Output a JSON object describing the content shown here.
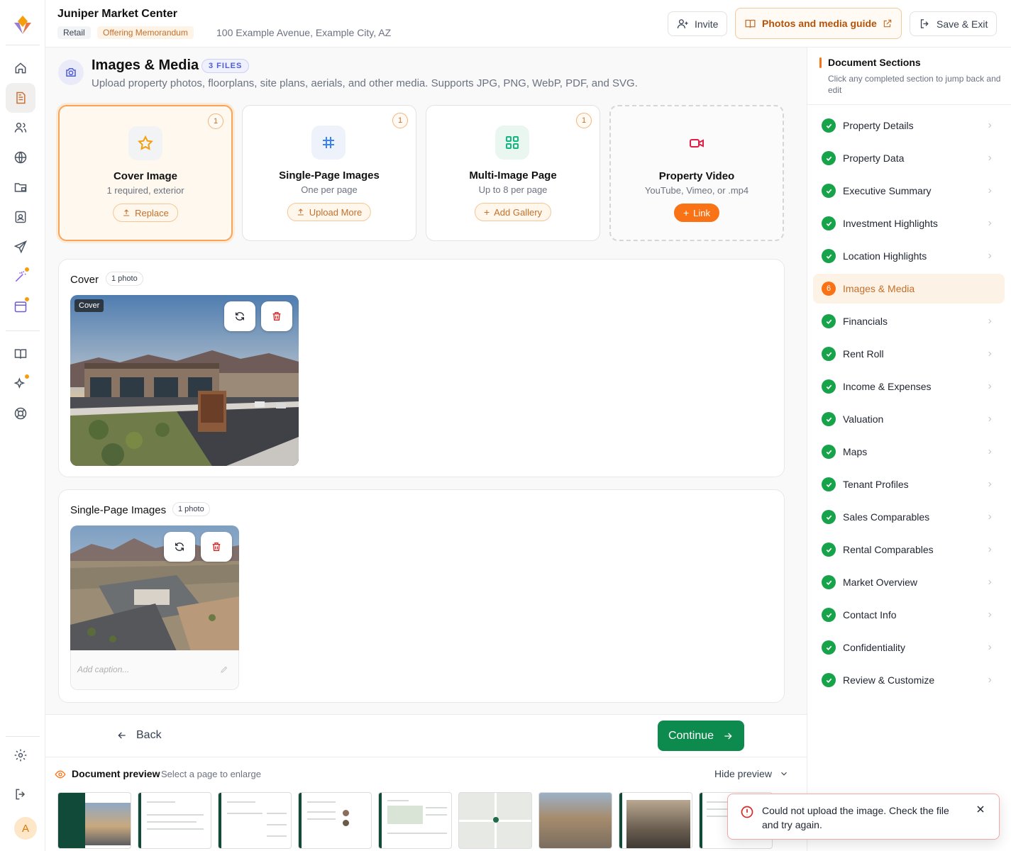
{
  "project": {
    "title": "Juniper Market Center",
    "tags": [
      "Retail",
      "Offering Memorandum"
    ],
    "address": "100 Example Avenue, Example City, AZ"
  },
  "topbar": {
    "invite": "Invite",
    "guide": "Photos and media guide",
    "save_exit": "Save & Exit"
  },
  "header": {
    "title": "Images & Media",
    "badge": "3 FILES",
    "subtitle": "Upload property photos, floorplans, site plans, aerials, and other media. Supports JPG, PNG, WebP, PDF, and SVG."
  },
  "cards": [
    {
      "title": "Cover Image",
      "sub": "1 required, exterior",
      "button": "Replace",
      "count": "1",
      "icon": "star-icon"
    },
    {
      "title": "Single-Page Images",
      "sub": "One per page",
      "button": "Upload More",
      "count": "1",
      "icon": "hash-icon"
    },
    {
      "title": "Multi-Image Page",
      "sub": "Up to 8 per page",
      "button": "Add Gallery",
      "count": "1",
      "icon": "grid-icon"
    },
    {
      "title": "Property Video",
      "sub": "YouTube, Vimeo, or .mp4",
      "button": "Link",
      "icon": "video-icon"
    }
  ],
  "cover_panel": {
    "title": "Cover",
    "count": "1 photo",
    "tag": "Cover"
  },
  "single_panel": {
    "title": "Single-Page Images",
    "count": "1 photo",
    "caption_placeholder": "Add caption..."
  },
  "nav": {
    "back": "Back",
    "continue": "Continue"
  },
  "preview": {
    "title": "Document preview",
    "sub": "Select a page to enlarge",
    "hide": "Hide preview"
  },
  "sidebar": {
    "title": "Document Sections",
    "subtitle": "Click any completed section to jump back and edit",
    "current_number": "6",
    "items": [
      {
        "label": "Property Details",
        "status": "done"
      },
      {
        "label": "Property Data",
        "status": "done"
      },
      {
        "label": "Executive Summary",
        "status": "done"
      },
      {
        "label": "Investment Highlights",
        "status": "done"
      },
      {
        "label": "Location Highlights",
        "status": "done"
      },
      {
        "label": "Images & Media",
        "status": "current"
      },
      {
        "label": "Financials",
        "status": "done"
      },
      {
        "label": "Rent Roll",
        "status": "done"
      },
      {
        "label": "Income & Expenses",
        "status": "done"
      },
      {
        "label": "Valuation",
        "status": "done"
      },
      {
        "label": "Maps",
        "status": "done"
      },
      {
        "label": "Tenant Profiles",
        "status": "done"
      },
      {
        "label": "Sales Comparables",
        "status": "done"
      },
      {
        "label": "Rental Comparables",
        "status": "done"
      },
      {
        "label": "Market Overview",
        "status": "done"
      },
      {
        "label": "Contact Info",
        "status": "done"
      },
      {
        "label": "Confidentiality",
        "status": "done"
      },
      {
        "label": "Review & Customize",
        "status": "done"
      }
    ]
  },
  "toast": {
    "message": "Could not upload the image. Check the file and try again."
  },
  "user": {
    "initial": "A"
  },
  "colors": {
    "accent": "#f97316",
    "success": "#16a34a",
    "primary": "#0d8a4e",
    "error": "#dc2626"
  }
}
